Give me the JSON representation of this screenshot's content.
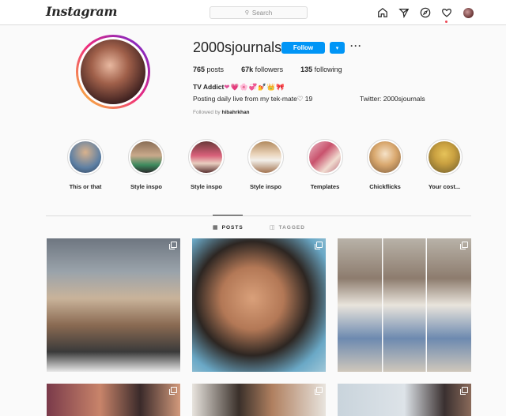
{
  "nav": {
    "logo": "Instagram",
    "search_placeholder": "Search",
    "icons": [
      "home-icon",
      "direct-icon",
      "explore-icon",
      "activity-heart-icon",
      "profile-avatar"
    ]
  },
  "profile": {
    "username": "2000sjournals",
    "follow_label": "Follow",
    "dropdown_label": "▾",
    "more_label": "···",
    "stats": [
      {
        "value": "765",
        "label": "posts"
      },
      {
        "value": "67k",
        "label": "followers"
      },
      {
        "value": "135",
        "label": "following"
      }
    ],
    "bio_name": "TV Addict",
    "bio_emojis": "❤💗🌸💞💅👑🎀",
    "bio_line": "Posting daily live from my tek-mate♡ 19",
    "bio_twitter": "Twitter: 2000sjournals",
    "followed_by_prefix": "Followed by ",
    "followed_by_user": "hibahrkhan"
  },
  "highlights": [
    {
      "label": "This or that"
    },
    {
      "label": "Style inspo"
    },
    {
      "label": "Style inspo"
    },
    {
      "label": "Style inspo"
    },
    {
      "label": "Templates"
    },
    {
      "label": "Chickflicks"
    },
    {
      "label": "Your cost..."
    }
  ],
  "tabs": {
    "posts_label": "POSTS",
    "tagged_label": "TAGGED"
  },
  "colors": {
    "accent": "#0095f6",
    "border": "#dbdbdb",
    "background": "#fafafa",
    "notification": "#ed4956"
  }
}
